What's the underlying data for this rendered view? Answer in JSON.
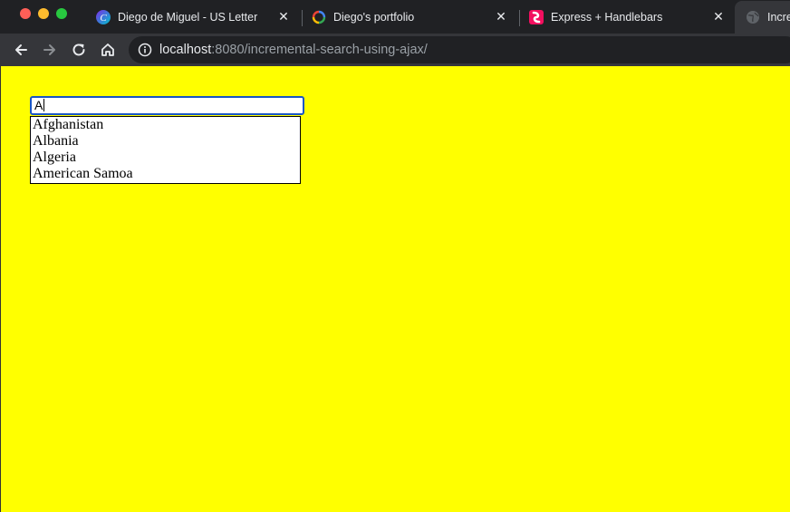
{
  "browser": {
    "tabs": [
      {
        "title": "Diego de Miguel - US Letter",
        "icon": "canva-icon"
      },
      {
        "title": "Diego's portfolio",
        "icon": "loading-spinner-icon"
      },
      {
        "title": "Express + Handlebars",
        "icon": "handlebars-icon"
      },
      {
        "title": "Incre",
        "icon": "globe-icon",
        "active": true
      }
    ],
    "address_bar": {
      "host": "localhost",
      "path": ":8080/incremental-search-using-ajax/"
    }
  },
  "page": {
    "background_color": "#ffff00",
    "search": {
      "value": "A"
    },
    "suggestions": [
      "Afghanistan",
      "Albania",
      "Algeria",
      "American Samoa"
    ]
  }
}
